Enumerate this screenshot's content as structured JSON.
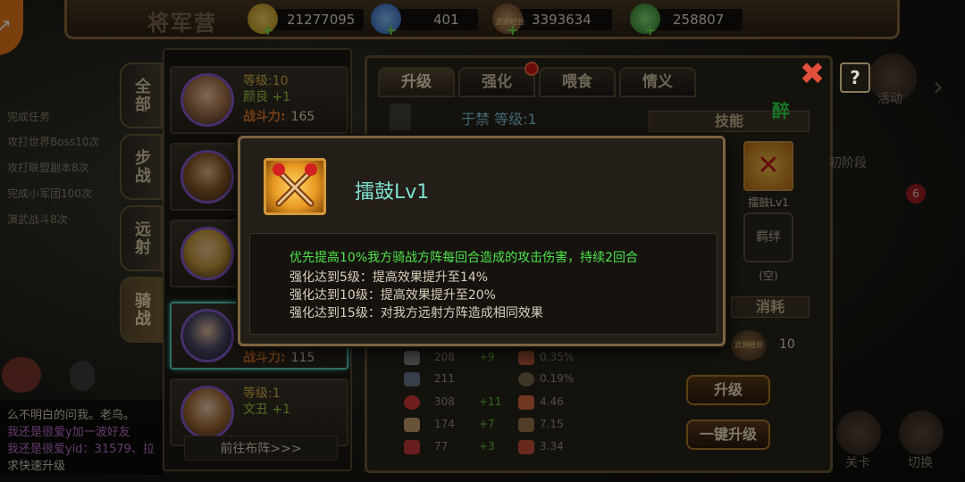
{
  "top_bar": {
    "camp_title": "将军营",
    "resources": [
      {
        "name": "coins",
        "value": "21277095",
        "icon": "coin-icon",
        "color": "#e8b830"
      },
      {
        "name": "gems",
        "value": "401",
        "icon": "gem-icon",
        "color": "#4a8ae0"
      },
      {
        "name": "general-exp",
        "value": "3393634",
        "icon": "general-exp-icon",
        "label": "武将经验",
        "color": "#9a6a3a"
      },
      {
        "name": "stamina",
        "value": "258807",
        "icon": "potion-icon",
        "color": "#3aa83a"
      }
    ]
  },
  "left_chat": {
    "tasks": [
      "完成任务",
      "攻打世界Boss10次",
      "攻打联盟副本8次",
      "完成小军团100次",
      "演武战斗8次"
    ],
    "messages": [
      {
        "text": "么不明白的问我。老鸟。",
        "color": "#d8d0bc"
      },
      {
        "text": "我还是很爱y加一波好友",
        "color": "#c070d0"
      },
      {
        "text": "我还是很爱yid：31579、拉",
        "color": "#c070d0"
      },
      {
        "text": "求快速升级",
        "color": "#d8d0bc"
      }
    ]
  },
  "categories": [
    {
      "label": "全部",
      "active": false
    },
    {
      "label": "步战",
      "active": false
    },
    {
      "label": "远射",
      "active": false
    },
    {
      "label": "骑战",
      "active": true
    }
  ],
  "heroes": [
    {
      "level": "等级:10",
      "name": "颜良",
      "plus": "+1",
      "power_label": "战斗力:",
      "power": "165",
      "selected": false
    },
    {
      "level": "",
      "name": "",
      "plus": "",
      "power_label": "",
      "power": "",
      "selected": false
    },
    {
      "level": "",
      "name": "",
      "plus": "",
      "power_label": "",
      "power": "",
      "selected": false
    },
    {
      "level": "",
      "name": "",
      "plus": "",
      "power_label": "战斗力:",
      "power": "115",
      "selected": true
    },
    {
      "level": "等级:1",
      "name": "文丑",
      "plus": "+1",
      "power_label": "",
      "power": "",
      "selected": false
    }
  ],
  "goto_formation": "前往布阵>>>",
  "tabs": [
    {
      "label": "升级",
      "active": true
    },
    {
      "label": "强化",
      "active": false,
      "badge": true
    },
    {
      "label": "喂食",
      "active": false
    },
    {
      "label": "情义",
      "active": false
    }
  ],
  "hero_header": "于禁  等级:1",
  "skill_header": "技能",
  "status_text": "醉",
  "skill_small_label": "擂鼓Lv1",
  "bond_label": "羁绊",
  "bond_empty": "(空)",
  "consume_header": "消耗",
  "cost": {
    "icon_label": "武将经验",
    "value": "10"
  },
  "buttons": {
    "upgrade": "升级",
    "one_key_upgrade": "一键升级"
  },
  "stats": [
    {
      "base": "208",
      "plus": "+9",
      "pct": "0.35%"
    },
    {
      "base": "211",
      "plus": "",
      "pct": "0.19%"
    },
    {
      "base": "308",
      "plus": "+11",
      "pct": "4.46"
    },
    {
      "base": "174",
      "plus": "+7",
      "pct": "7.15"
    },
    {
      "base": "77",
      "plus": "+3",
      "pct": "3.34"
    }
  ],
  "popup": {
    "title": "擂鼓Lv1",
    "main_effect": "优先提高10%我方骑战方阵每回合造成的攻击伤害，持续2回合",
    "upgrades": [
      "强化达到5级：提高效果提升至14%",
      "强化达到10级：提高效果提升至20%",
      "强化达到15级：对我方远射方阵造成相同效果"
    ]
  },
  "right_side": {
    "activity": "活动",
    "stage": "初阶段",
    "checkpoint": "关卡",
    "switch": "切换",
    "badge_count": "6"
  }
}
